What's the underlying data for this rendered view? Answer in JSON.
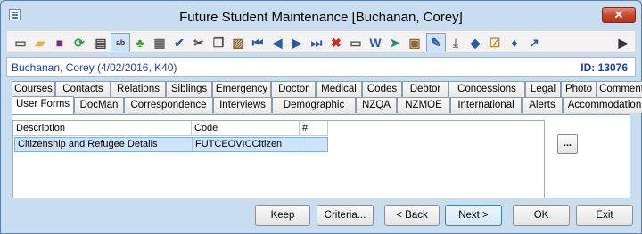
{
  "window": {
    "title": "Future Student Maintenance  [Buchanan, Corey]",
    "close_label": "✕"
  },
  "toolbar": {
    "buttons": [
      {
        "icon": "new-document-icon",
        "glyph": "▭",
        "color": "#5a5a5a"
      },
      {
        "icon": "open-folder-icon",
        "glyph": "▰",
        "color": "#e0b64a"
      },
      {
        "icon": "save-icon",
        "glyph": "■",
        "color": "#7b2a8c"
      },
      {
        "icon": "refresh-icon",
        "glyph": "⟳",
        "color": "#2c9a3c"
      },
      {
        "icon": "print-icon",
        "glyph": "▤",
        "color": "#4a4a4a"
      },
      {
        "icon": "text-field-icon",
        "glyph": "ab",
        "color": "#333333"
      },
      {
        "icon": "tree-icon",
        "glyph": "♣",
        "color": "#3f9a2e"
      },
      {
        "icon": "calculator-icon",
        "glyph": "▦",
        "color": "#666666"
      },
      {
        "icon": "spellcheck-icon",
        "glyph": "✔",
        "color": "#2a5aa8"
      },
      {
        "icon": "cut-icon",
        "glyph": "✂",
        "color": "#444444"
      },
      {
        "icon": "copy-icon",
        "glyph": "❐",
        "color": "#555555"
      },
      {
        "icon": "paste-icon",
        "glyph": "▨",
        "color": "#8a6a3a"
      },
      {
        "icon": "first-record-icon",
        "glyph": "⏮",
        "color": "#2a5aa8"
      },
      {
        "icon": "previous-record-icon",
        "glyph": "◀",
        "color": "#2a5aa8"
      },
      {
        "icon": "next-record-icon",
        "glyph": "▶",
        "color": "#2a5aa8"
      },
      {
        "icon": "last-record-icon",
        "glyph": "⏭",
        "color": "#2a5aa8"
      },
      {
        "icon": "delete-icon",
        "glyph": "✖",
        "color": "#d0261e"
      },
      {
        "icon": "card-icon",
        "glyph": "▭",
        "color": "#555555"
      },
      {
        "icon": "word-document-icon",
        "glyph": "W",
        "color": "#2a5aa8"
      },
      {
        "icon": "send-icon",
        "glyph": "➤",
        "color": "#2a8a6a"
      },
      {
        "icon": "clipboard-icon",
        "glyph": "▣",
        "color": "#8a6a3a"
      },
      {
        "icon": "approve-icon",
        "glyph": "✎",
        "color": "#2a5aa8"
      },
      {
        "icon": "download-icon",
        "glyph": "⤓",
        "color": "#7a7a7a"
      },
      {
        "icon": "tag-icon",
        "glyph": "◆",
        "color": "#2a5aa8"
      },
      {
        "icon": "checklist-icon",
        "glyph": "☑",
        "color": "#c48a2a"
      },
      {
        "icon": "pin-icon",
        "glyph": "♦",
        "color": "#2a4a9a"
      },
      {
        "icon": "arrow-icon",
        "glyph": "↗",
        "color": "#2a5aa8"
      },
      {
        "icon": "exit-icon",
        "glyph": "▶",
        "color": "#333333"
      }
    ]
  },
  "info": {
    "student": "Buchanan, Corey (4/02/2016, K40)",
    "id_label": "ID: 13076"
  },
  "tabs": {
    "row1": [
      "Courses",
      "Contacts",
      "Relations",
      "Siblings",
      "Emergency",
      "Doctor",
      "Medical",
      "Codes",
      "Debtor",
      "Concessions",
      "Legal",
      "Photo",
      "Comment"
    ],
    "row2": [
      "User Forms",
      "DocMan",
      "Correspondence",
      "Interviews",
      "Demographic",
      "NZQA",
      "NZMOE",
      "International",
      "Alerts",
      "Accommodation"
    ],
    "selected": "User Forms"
  },
  "grid": {
    "columns": [
      "Description",
      "Code",
      "#"
    ],
    "rows": [
      [
        "Citizenship and Refugee Details",
        "FUTCEOVICCitizen",
        ""
      ]
    ]
  },
  "ellipsis_label": "...",
  "buttons": {
    "keep": "Keep",
    "criteria": "Criteria...",
    "back": "< Back",
    "next": "Next >",
    "ok": "OK",
    "exit": "Exit"
  }
}
